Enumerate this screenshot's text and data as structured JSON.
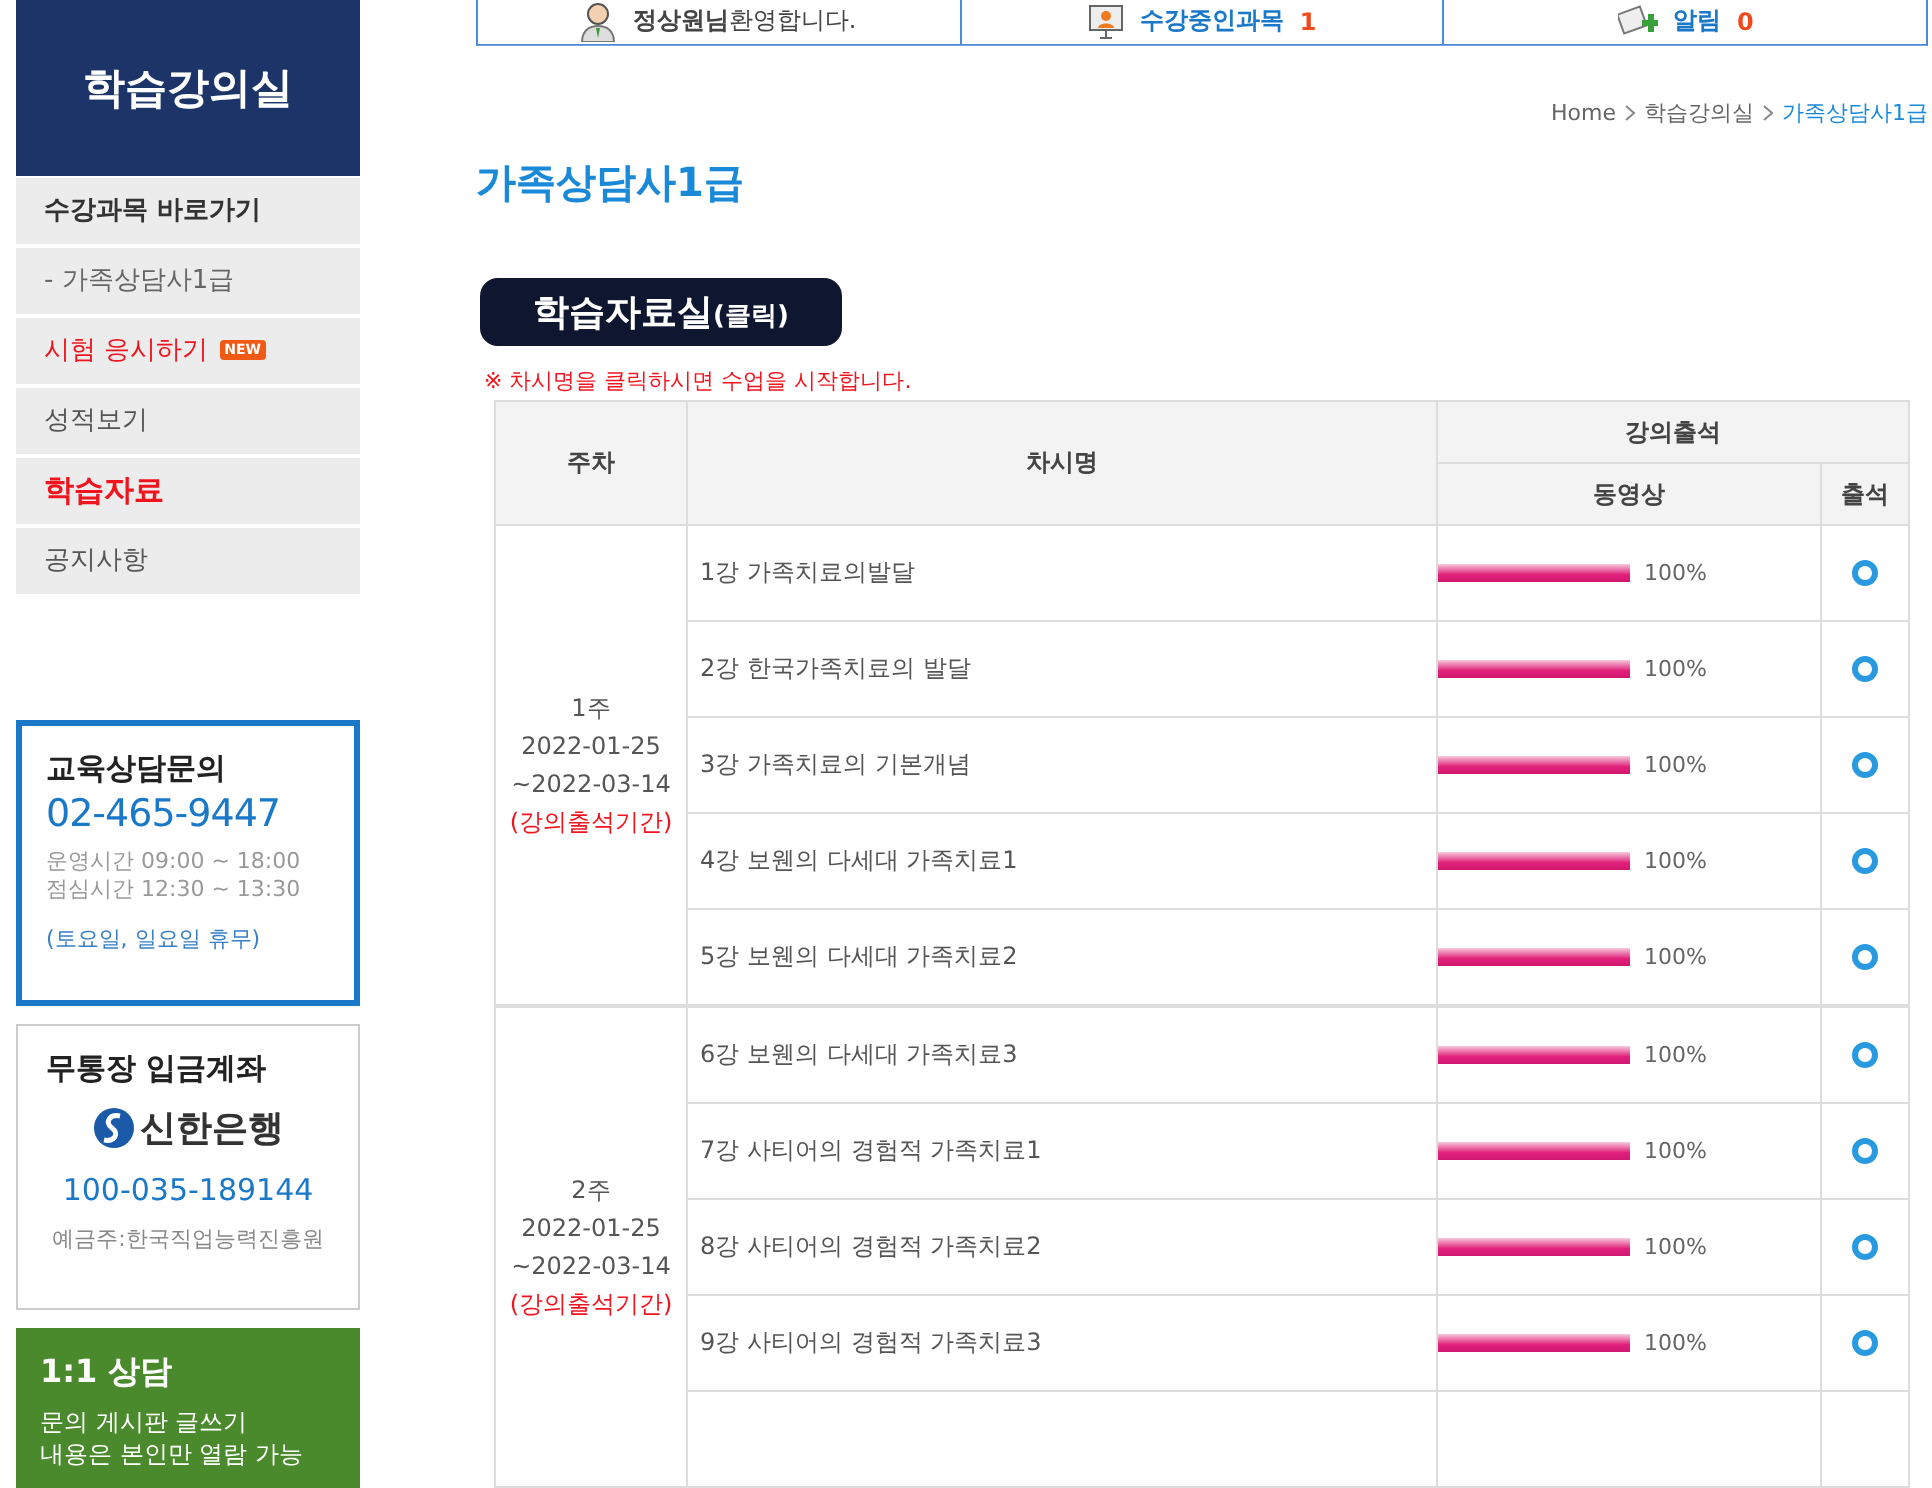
{
  "sidebar": {
    "title": "학습강의실",
    "menu": [
      {
        "label": "수강과목 바로가기",
        "kind": "heading",
        "selected": false
      },
      {
        "label": "- 가족상담사1급",
        "kind": "sub",
        "selected": false
      },
      {
        "label": "시험 응시하기",
        "kind": "item",
        "selected": false,
        "badge": "NEW"
      },
      {
        "label": "성적보기",
        "kind": "item",
        "selected": false
      },
      {
        "label": "학습자료",
        "kind": "item",
        "selected": true
      },
      {
        "label": "공지사항",
        "kind": "item",
        "selected": false
      }
    ],
    "contact": {
      "title": "교육상담문의",
      "phone": "02-465-9447",
      "hours": [
        "운영시간 09:00 ~ 18:00",
        "점심시간 12:30 ~ 13:30"
      ],
      "note": "(토요일, 일요일 휴무)"
    },
    "bank": {
      "title": "무통장 입금계좌",
      "bank_name": "신한은행",
      "account": "100-035-189144",
      "holder": "예금주:한국직업능력진흥원"
    },
    "qna": {
      "title": "1:1 상담",
      "lines": [
        "문의 게시판 글쓰기",
        "내용은 본인만 열람 가능"
      ]
    }
  },
  "topbar": [
    {
      "kind": "user",
      "name": "정상원님",
      "text": "환영합니다."
    },
    {
      "kind": "courses",
      "label": "수강중인과목",
      "count": "1"
    },
    {
      "kind": "alerts",
      "label": "알림",
      "count": "0"
    }
  ],
  "breadcrumb": [
    "Home",
    "학습강의실",
    "가족상담사1급"
  ],
  "page_title": "가족상담사1급",
  "library_button": {
    "label": "학습자료실",
    "suffix": "(클릭)"
  },
  "notice": "※ 차시명을 클릭하시면 수업을 시작합니다.",
  "table": {
    "columns": [
      "주차",
      "차시명",
      "강의출석"
    ],
    "subcolumns": [
      "동영상",
      "출석"
    ],
    "weeks": [
      {
        "week": "1주",
        "start": "2022-01-25",
        "end": "~2022-03-14",
        "period": "(강의출석기간)",
        "lessons": [
          {
            "title": "1강 가족치료의발달",
            "level": 1,
            "reading": "100%",
            "attended": true
          },
          {
            "title": "2강 한국가족치료의 발달",
            "level": 1,
            "reading": "100%",
            "attended": true
          },
          {
            "title": "3강 가족치료의 기본개념",
            "level": 1,
            "reading": "100%",
            "attended": true
          },
          {
            "title": "4강 보웬의 다세대 가족치료1",
            "level": 1,
            "reading": "100%",
            "attended": true
          },
          {
            "title": "5강 보웬의 다세대 가족치료2",
            "level": 1,
            "reading": "100%",
            "attended": true
          }
        ]
      },
      {
        "week": "2주",
        "start": "2022-01-25",
        "end": "~2022-03-14",
        "period": "(강의출석기간)",
        "lessons": [
          {
            "title": "6강 보웬의 다세대 가족치료3",
            "level": 1,
            "reading": "100%",
            "attended": true
          },
          {
            "title": "7강 사티어의 경험적 가족치료1",
            "level": 1,
            "reading": "100%",
            "attended": true
          },
          {
            "title": "8강 사티어의 경험적 가족치료2",
            "level": 1,
            "reading": "100%",
            "attended": true
          },
          {
            "title": "9강 사티어의 경험적 가족치료3",
            "level": 1,
            "reading": "100%",
            "attended": true
          }
        ]
      }
    ]
  }
}
